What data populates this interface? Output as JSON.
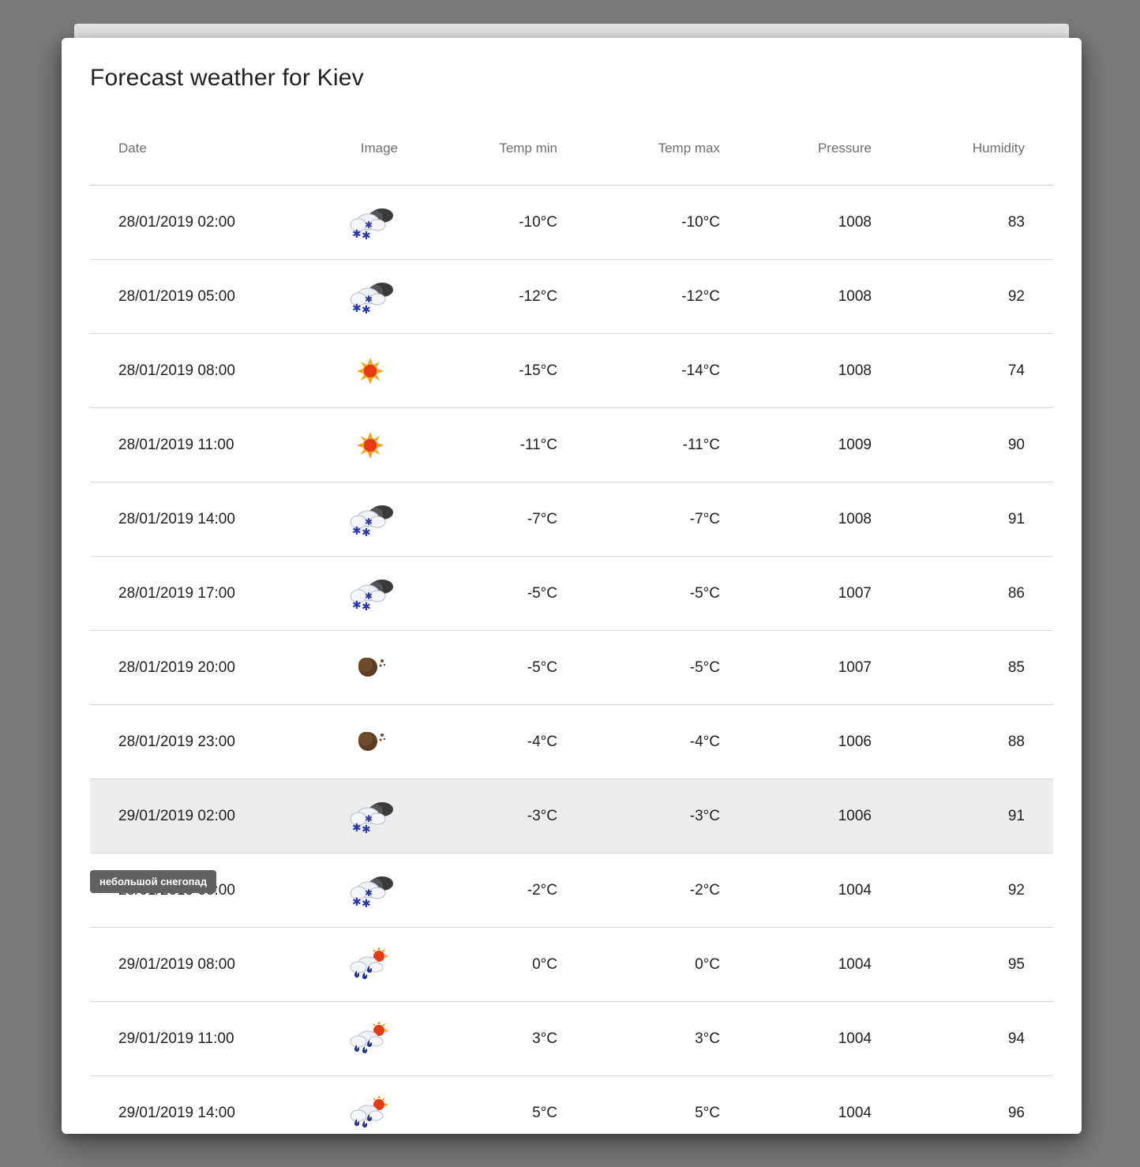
{
  "dialog": {
    "title": "Forecast weather for Kiev"
  },
  "table": {
    "columns": {
      "date": "Date",
      "image": "Image",
      "temp_min": "Temp min",
      "temp_max": "Temp max",
      "pressure": "Pressure",
      "humidity": "Humidity"
    },
    "rows": [
      {
        "date": "28/01/2019 02:00",
        "icon": "light-snow-icon",
        "temp_min": "-10°C",
        "temp_max": "-10°C",
        "pressure": "1008",
        "humidity": "83"
      },
      {
        "date": "28/01/2019 05:00",
        "icon": "light-snow-icon",
        "temp_min": "-12°C",
        "temp_max": "-12°C",
        "pressure": "1008",
        "humidity": "92"
      },
      {
        "date": "28/01/2019 08:00",
        "icon": "clear-sun-icon",
        "temp_min": "-15°C",
        "temp_max": "-14°C",
        "pressure": "1008",
        "humidity": "74"
      },
      {
        "date": "28/01/2019 11:00",
        "icon": "clear-sun-icon",
        "temp_min": "-11°C",
        "temp_max": "-11°C",
        "pressure": "1009",
        "humidity": "90"
      },
      {
        "date": "28/01/2019 14:00",
        "icon": "light-snow-icon",
        "temp_min": "-7°C",
        "temp_max": "-7°C",
        "pressure": "1008",
        "humidity": "91"
      },
      {
        "date": "28/01/2019 17:00",
        "icon": "light-snow-icon",
        "temp_min": "-5°C",
        "temp_max": "-5°C",
        "pressure": "1007",
        "humidity": "86"
      },
      {
        "date": "28/01/2019 20:00",
        "icon": "clear-night-moon-icon",
        "temp_min": "-5°C",
        "temp_max": "-5°C",
        "pressure": "1007",
        "humidity": "85"
      },
      {
        "date": "28/01/2019 23:00",
        "icon": "clear-night-moon-icon",
        "temp_min": "-4°C",
        "temp_max": "-4°C",
        "pressure": "1006",
        "humidity": "88"
      },
      {
        "date": "29/01/2019 02:00",
        "icon": "light-snow-icon",
        "temp_min": "-3°C",
        "temp_max": "-3°C",
        "pressure": "1006",
        "humidity": "91"
      },
      {
        "date": "29/01/2019 05:00",
        "icon": "light-snow-icon",
        "temp_min": "-2°C",
        "temp_max": "-2°C",
        "pressure": "1004",
        "humidity": "92"
      },
      {
        "date": "29/01/2019 08:00",
        "icon": "rain-sun-icon",
        "temp_min": "0°C",
        "temp_max": "0°C",
        "pressure": "1004",
        "humidity": "95"
      },
      {
        "date": "29/01/2019 11:00",
        "icon": "rain-sun-icon",
        "temp_min": "3°C",
        "temp_max": "3°C",
        "pressure": "1004",
        "humidity": "94"
      },
      {
        "date": "29/01/2019 14:00",
        "icon": "rain-sun-icon",
        "temp_min": "5°C",
        "temp_max": "5°C",
        "pressure": "1004",
        "humidity": "96"
      }
    ]
  },
  "tooltip": {
    "text": "небольшой снегопад"
  }
}
